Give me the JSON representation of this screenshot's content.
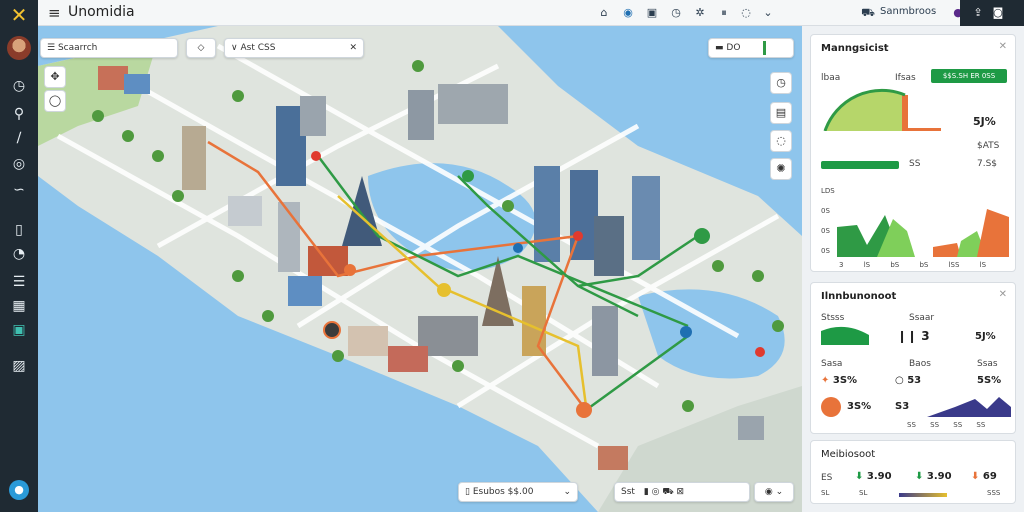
{
  "app": {
    "title": "Unomidia"
  },
  "topbar": {
    "right_label": "Sanmbroos"
  },
  "map": {
    "search_chip": "Scaarrch",
    "filter_chip": "Ast CSS",
    "layer_chip": "DO",
    "bottom_chip": "Esubos $$.00",
    "bottom_tools": "Sst",
    "colors": {
      "water": "#8ec5ec",
      "land": "#dfe4de",
      "green": "#7fb463",
      "route_orange": "#e8733a",
      "route_green": "#2f9a45",
      "route_yellow": "#e6c02e"
    }
  },
  "panel1": {
    "title": "Manngsicist",
    "label_a": "lbaa",
    "label_b": "Ifsas",
    "badge": "$$S.SH ER 0SS",
    "pct": "5J%",
    "val_a": "$ATS",
    "val_b": "SS",
    "val_c": "7.S$",
    "axis": [
      "LDS",
      "0S",
      "0S",
      "0S"
    ],
    "axis_x": [
      "3",
      "lS",
      "bS",
      "bS",
      "lSS",
      "lS",
      "bS"
    ]
  },
  "panel2": {
    "title": "Ilnnbunonoot",
    "row1_a": "Stsss",
    "row1_b": "Ssaar",
    "row1_val": "3",
    "row1_pct": "5J%",
    "row2_a": "Sasa",
    "row2_b": "Baos",
    "row2_c": "Ssas",
    "row2_v1": "3S%",
    "row2_v2": "53",
    "row2_v3": "5S%",
    "row3_v1": "3S%",
    "row3_v2": "S3",
    "axis_x": [
      "SS",
      "SS",
      "SS",
      "SS"
    ]
  },
  "panel3": {
    "title": "Meibiosoot",
    "v1": "3.90",
    "v2": "3.90",
    "v3": "69",
    "l1": "ES",
    "l2": "SL",
    "l3": "SL",
    "l4": "SSS"
  }
}
